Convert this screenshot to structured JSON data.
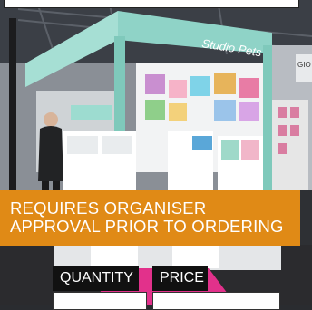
{
  "top_input": {
    "value": ""
  },
  "photo": {
    "description_icon": "exhibition-booth-photo",
    "stand_sign": "Studio Pets",
    "side_sign": "GIO"
  },
  "notice": {
    "line1": "REQUIRES ORGANISER",
    "line2": "APPROVAL PRIOR TO ORDERING",
    "bg_color": "#e08a16"
  },
  "order": {
    "quantity_label": "QUANTITY",
    "price_label": "PRICE",
    "quantity_value": "",
    "price_value": ""
  }
}
